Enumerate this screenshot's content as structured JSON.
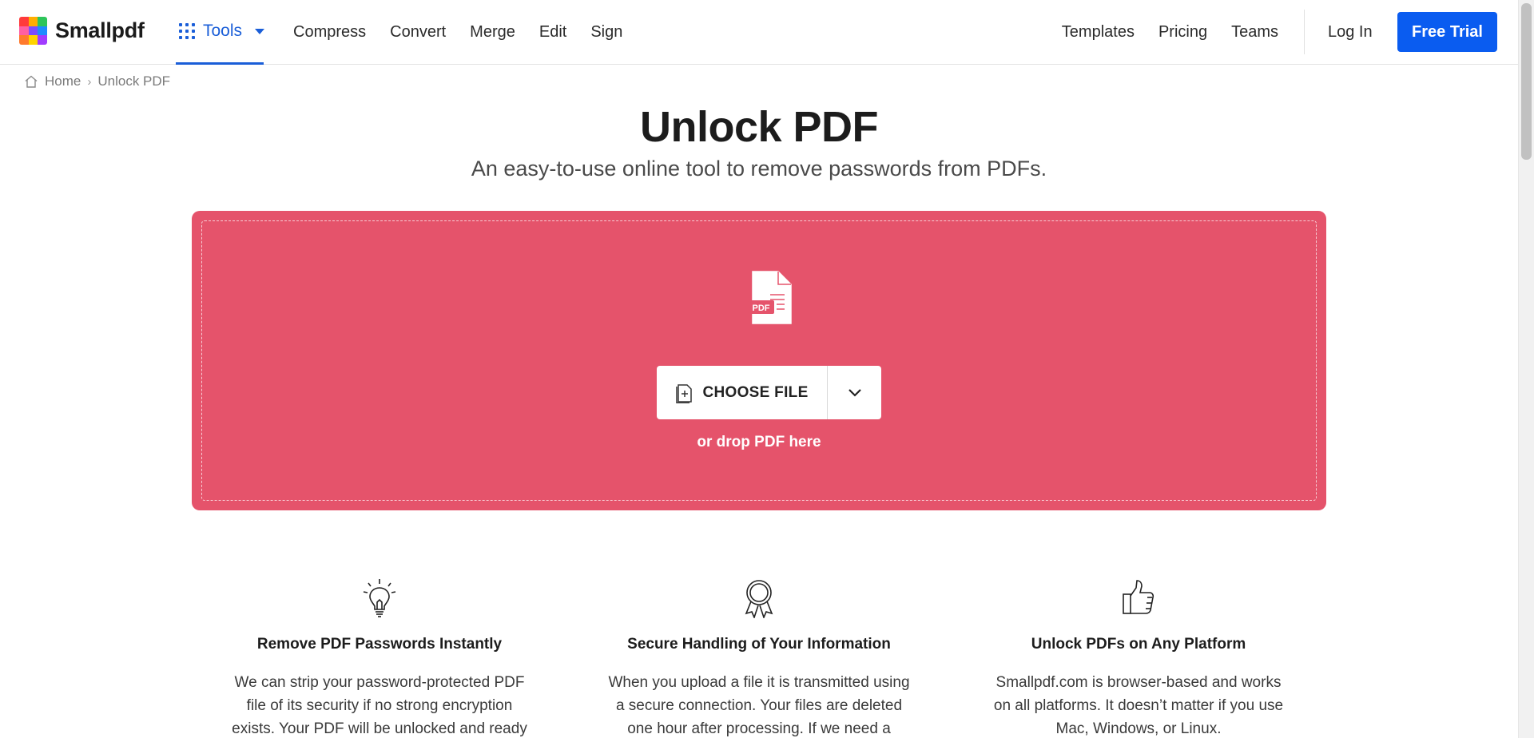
{
  "header": {
    "brand": "Smallpdf",
    "logo_colors": [
      "#ff3b3b",
      "#ffae00",
      "#2ec55a",
      "#ff5fa2",
      "#7a4dff",
      "#1f8bff",
      "#ff7a2d",
      "#ffd400",
      "#a13bff"
    ],
    "tools_label": "Tools",
    "nav_left": [
      "Compress",
      "Convert",
      "Merge",
      "Edit",
      "Sign"
    ],
    "nav_right": [
      "Templates",
      "Pricing",
      "Teams"
    ],
    "login": "Log In",
    "free_trial": "Free Trial",
    "accent": "#0a5cf0"
  },
  "breadcrumb": {
    "home": "Home",
    "current": "Unlock PDF"
  },
  "hero": {
    "title": "Unlock PDF",
    "subtitle": "An easy-to-use online tool to remove passwords from PDFs."
  },
  "dropzone": {
    "color": "#e5536b",
    "file_badge": "PDF",
    "choose_file": "CHOOSE FILE",
    "drop_hint": "or drop PDF here"
  },
  "features": [
    {
      "icon": "lightbulb-icon",
      "title": "Remove PDF Passwords Instantly",
      "text": "We can strip your password-protected PDF file of its security if no strong encryption exists. Your PDF will be unlocked and ready"
    },
    {
      "icon": "award-ribbon-icon",
      "title": "Secure Handling of Your Information",
      "text": "When you upload a file it is transmitted using a secure connection. Your files are deleted one hour after processing. If we need a"
    },
    {
      "icon": "thumbs-up-icon",
      "title": "Unlock PDFs on Any Platform",
      "text": "Smallpdf.com is browser-based and works on all platforms. It doesn’t matter if you use Mac, Windows, or Linux."
    }
  ]
}
